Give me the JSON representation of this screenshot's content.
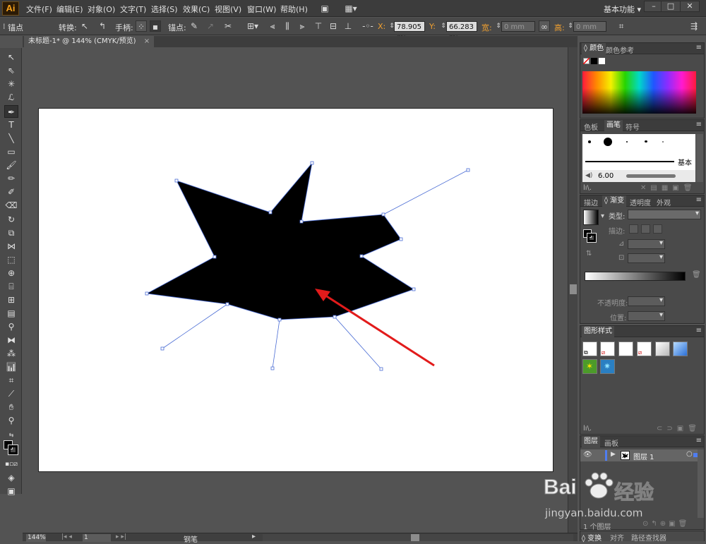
{
  "app": {
    "logo": "Ai"
  },
  "menu": [
    "文件(F)",
    "编辑(E)",
    "对象(O)",
    "文字(T)",
    "选择(S)",
    "效果(C)",
    "视图(V)",
    "窗口(W)",
    "帮助(H)"
  ],
  "workspace_label": "基本功能",
  "window_buttons": {
    "minimize": "–",
    "restore": "□",
    "close": "✕"
  },
  "control_bar": {
    "selection_label": "锚点",
    "convert_label": "转换:",
    "handles_label": "手柄:",
    "anchors_label": "锚点:",
    "x_label": "X:",
    "x_value": "78.905 mı",
    "y_label": "Y:",
    "y_value": "66.283 mı",
    "w_label": "宽:",
    "w_value": "0 mm",
    "h_label": "高:",
    "h_value": "0 mm"
  },
  "document_tab": {
    "title": "未标题-1* @ 144% (CMYK/预览)",
    "close": "×"
  },
  "status_bar": {
    "zoom": "144%",
    "page": "1",
    "tool_name": "钢笔"
  },
  "panels": {
    "color": {
      "tabs": [
        "颜色",
        "颜色参考"
      ]
    },
    "brushes": {
      "tabs": [
        "色板",
        "画笔",
        "符号"
      ],
      "basic_label": "基本",
      "brush_size": "6.00"
    },
    "gradient": {
      "tabs": [
        "描边",
        "渐变",
        "透明度",
        "外观"
      ],
      "type_label": "类型:",
      "stroke_label": "描边:",
      "opacity_label": "不透明度:",
      "position_label": "位置:"
    },
    "graphic_styles": {
      "tabs": [
        "图形样式"
      ]
    },
    "layers": {
      "tabs": [
        "图层",
        "画板"
      ],
      "layer_name": "图层 1",
      "layer_count": "1 个图层"
    },
    "bottom": {
      "tabs": [
        "变换",
        "对齐",
        "路径查找器"
      ]
    }
  },
  "watermark": {
    "brand": "Bai",
    "brand2": "经验",
    "url": "jingyan.baidu.com"
  },
  "colors": {
    "accent": "#f7a21c",
    "arrow": "#e21b1b",
    "shape": "#000000",
    "anchor": "#4a6cd4"
  }
}
